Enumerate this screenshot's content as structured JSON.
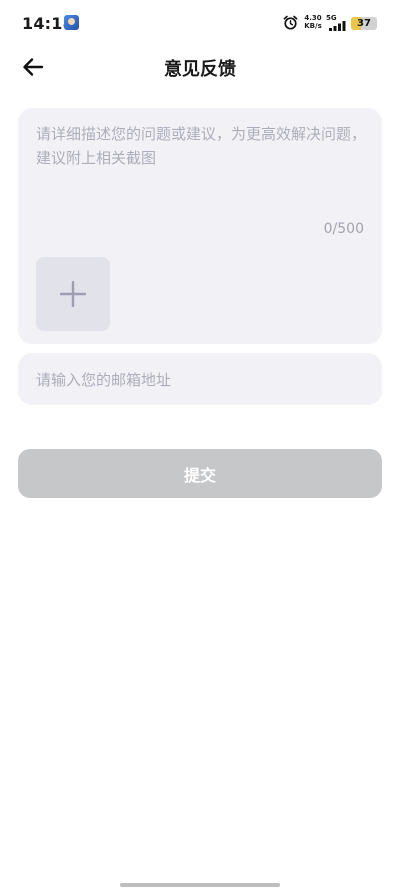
{
  "status_bar": {
    "time": "14:18",
    "network_speed_value": "4.30",
    "network_speed_unit": "KB/s",
    "network_type": "5G",
    "battery_level": "37",
    "battery_fraction": 0.37,
    "icons": [
      "app-notification-icon",
      "alarm-icon",
      "signal-icon",
      "battery-icon"
    ]
  },
  "header": {
    "back_icon": "arrow-left-icon",
    "title": "意见反馈"
  },
  "feedback": {
    "placeholder": "请详细描述您的问题或建议，为更高效解决问题，建议附上相关截图",
    "value": "",
    "char_counter": "0/500",
    "add_image_icon": "plus-icon"
  },
  "email": {
    "placeholder": "请输入您的邮箱地址",
    "value": ""
  },
  "submit": {
    "label": "提交",
    "disabled_color": "#c6c7c9"
  }
}
